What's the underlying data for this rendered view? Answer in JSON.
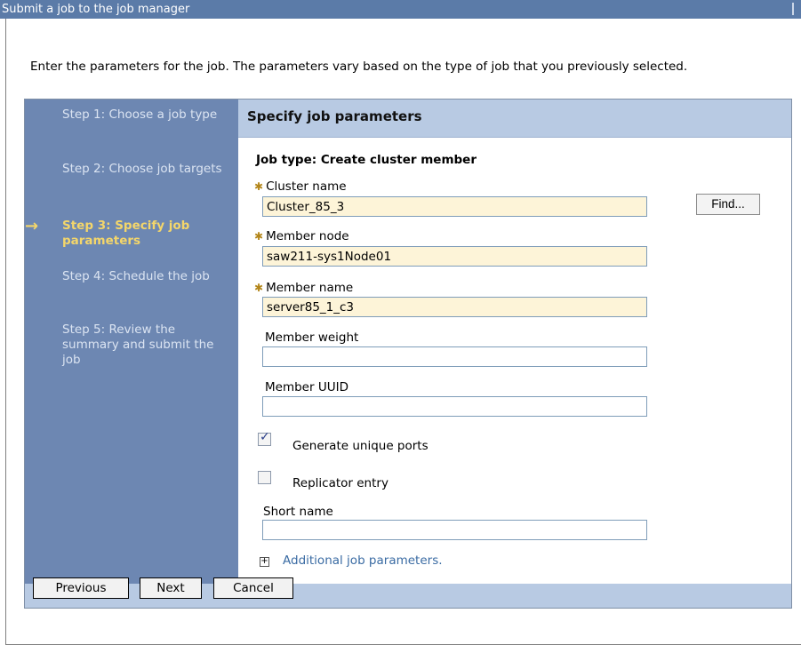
{
  "window": {
    "title": "Submit a job to the job manager"
  },
  "intro": "Enter the parameters for the job. The parameters vary based on the type of job that you previously selected.",
  "steps": [
    {
      "label": "Step 1: Choose a job type",
      "current": false
    },
    {
      "label": "Step 2: Choose job targets",
      "current": false
    },
    {
      "label": "Step 3: Specify job parameters",
      "current": true
    },
    {
      "label": "Step 4: Schedule the job",
      "current": false
    },
    {
      "label": "Step 5: Review the summary and submit the job",
      "current": false
    }
  ],
  "panel": {
    "heading": "Specify job parameters",
    "job_type": "Job type: Create cluster member",
    "fields": {
      "cluster_name": {
        "label": "Cluster name",
        "value": "Cluster_85_3",
        "required": true
      },
      "member_node": {
        "label": "Member node",
        "value": "saw211-sys1Node01",
        "required": true
      },
      "member_name": {
        "label": "Member name",
        "value": "server85_1_c3",
        "required": true
      },
      "member_weight": {
        "label": "Member weight",
        "value": ""
      },
      "member_uuid": {
        "label": "Member UUID",
        "value": ""
      },
      "short_name": {
        "label": "Short name",
        "value": ""
      }
    },
    "find_button": "Find...",
    "generate_ports": {
      "label": "Generate unique ports",
      "checked": true
    },
    "replicator_entry": {
      "label": "Replicator entry",
      "checked": false
    },
    "additional_link": "Additional job parameters."
  },
  "buttons": {
    "previous": "Previous",
    "next": "Next",
    "cancel": "Cancel"
  },
  "colors": {
    "title_bar": "#5b7ba8",
    "steps_bg": "#6d87b2",
    "current_step": "#f4d66a",
    "panel_header": "#b8cae3",
    "required_field": "#fdf4d8",
    "link": "#3a6ba3"
  },
  "icons": {
    "current_step": "right-arrow-icon",
    "required": "asterisk-icon",
    "expand": "plus-box-icon"
  }
}
